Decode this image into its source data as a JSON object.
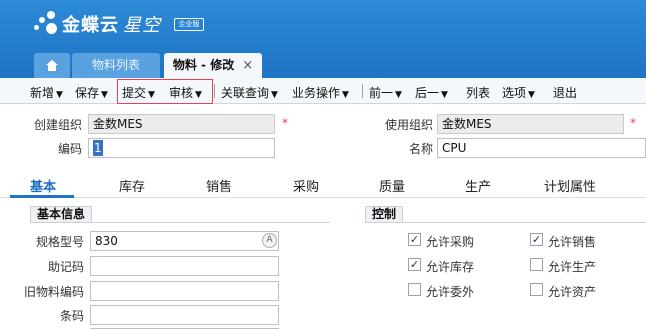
{
  "app": {
    "brand": "金蝶云",
    "product": "星空",
    "edition": "企业版"
  },
  "tabs": {
    "list_label": "物料列表",
    "active_label": "物料 - 修改",
    "close_glyph": "×"
  },
  "toolbar": {
    "add": "新增",
    "save": "保存",
    "submit": "提交",
    "audit": "审核",
    "related_query": "关联查询",
    "business_ops": "业务操作",
    "prev": "前一",
    "next": "后一",
    "list": "列表",
    "options": "选项",
    "exit": "退出"
  },
  "form": {
    "create_org_label": "创建组织",
    "create_org_value": "金数MES",
    "use_org_label": "使用组织",
    "use_org_value": "金数MES",
    "code_label": "编码",
    "code_value": "1",
    "name_label": "名称",
    "name_value": "CPU",
    "required_mark": "*"
  },
  "detail_tabs": [
    "基本",
    "库存",
    "销售",
    "采购",
    "质量",
    "生产",
    "计划属性"
  ],
  "basic_info": {
    "title": "基本信息",
    "spec_label": "规格型号",
    "spec_value": "830",
    "mnemonic_label": "助记码",
    "old_code_label": "旧物料编码",
    "barcode_label": "条码"
  },
  "control": {
    "title": "控制",
    "items": [
      {
        "label": "允许采购",
        "checked": true
      },
      {
        "label": "允许销售",
        "checked": true
      },
      {
        "label": "允许库存",
        "checked": true
      },
      {
        "label": "允许生产",
        "checked": false
      },
      {
        "label": "允许委外",
        "checked": false
      },
      {
        "label": "允许资产",
        "checked": false
      }
    ]
  },
  "check_glyph": "✓",
  "search_glyph": "A"
}
